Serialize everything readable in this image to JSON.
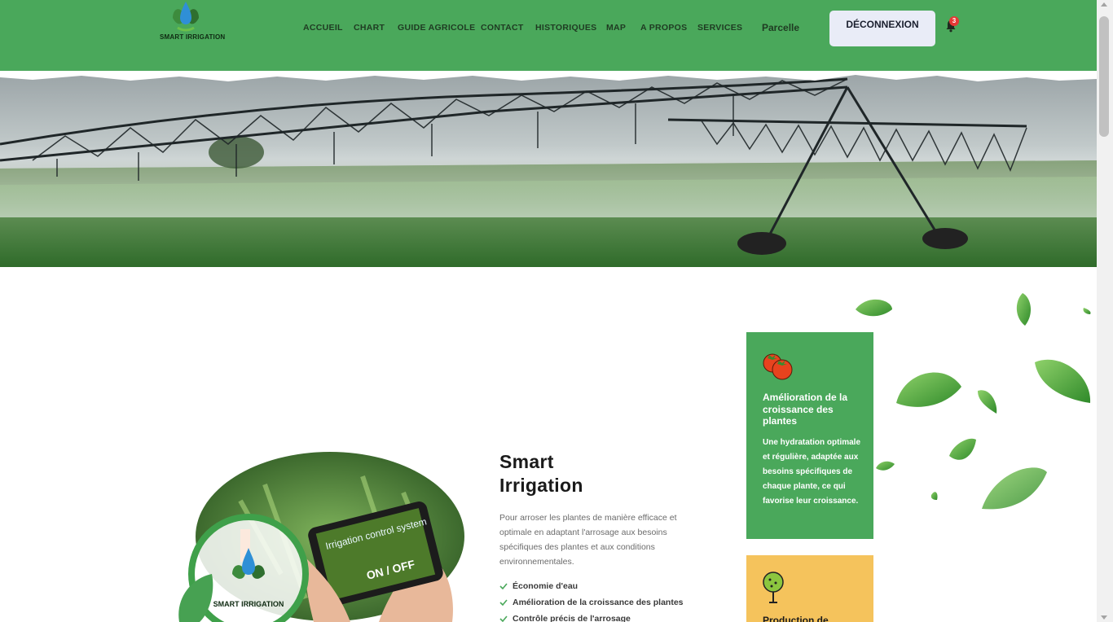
{
  "header": {
    "logo_text": "SMART IRRIGATION",
    "nav": [
      "ACCUEIL",
      "CHART",
      "GUIDE AGRICOLE",
      "CONTACT",
      "HISTORIQUES",
      "MAP",
      "A PROPOS",
      "SERVICES"
    ],
    "parcelle": "Parcelle",
    "logout": "DÉCONNEXION",
    "notification_count": "3",
    "icons": [
      "bell-icon"
    ]
  },
  "intro": {
    "title_line1": "Smart",
    "title_line2": "Irrigation",
    "description": "Pour arroser les plantes de manière efficace et optimale en adaptant l'arrosage aux besoins spécifiques des plantes et aux conditions environnementales.",
    "features": [
      "Économie d'eau",
      "Amélioration de la croissance des plantes",
      "Contrôle précis de l'arrosage"
    ],
    "illustration_logo_text": "SMART IRRIGATION",
    "tablet_text": "Irrigation control system",
    "tablet_switch": "ON / OFF"
  },
  "cards": [
    {
      "icon": "tomato-icon",
      "title": "Amélioration de la croissance des plantes",
      "text": "Une hydratation optimale et régulière, adaptée aux besoins spécifiques de chaque plante, ce qui favorise leur croissance."
    },
    {
      "icon": "tree-icon",
      "title": "Production de"
    }
  ],
  "colors": {
    "primary_green": "#4aa85b",
    "card_yellow": "#f5c35c",
    "button_bg": "#e9ecf7",
    "badge_red": "#e53935"
  }
}
